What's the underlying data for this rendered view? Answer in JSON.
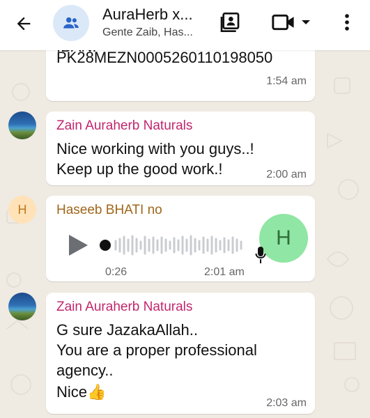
{
  "header": {
    "back_icon": "arrow-left-icon",
    "group_icon": "group-icon",
    "title": "AuraHerb x...",
    "subtitle": "Gente Zaib, Has...",
    "contacts_icon": "contact-card-icon",
    "video_icon": "video-camera-icon",
    "dropdown_icon": "caret-down-icon",
    "menu_icon": "more-vertical-icon"
  },
  "messages": [
    {
      "partial_top_text": "IBAN:",
      "lines": [
        "PK28MEZN0005260110198050"
      ],
      "time": "1:54 am"
    },
    {
      "sender": "Zain Auraherb Naturals",
      "sender_color": "#c0266d",
      "lines": [
        "Nice working with you guys..!",
        "Keep up the good work.!"
      ],
      "time": "2:00 am"
    },
    {
      "sender": "Haseeb BHATI no",
      "sender_color": "#a0661a",
      "avatar_letter": "H",
      "voice": {
        "duration": "0:26",
        "time": "2:01 am",
        "badge_letter": "H",
        "play_icon": "play-icon",
        "mic_icon": "microphone-icon"
      }
    },
    {
      "sender": "Zain Auraherb Naturals",
      "sender_color": "#c0266d",
      "lines": [
        "G sure JazakaAllah..",
        "You are a proper professional",
        "agency..",
        "Nice👍"
      ],
      "time": "2:03 am"
    }
  ],
  "colors": {
    "chat_background": "#efeae2",
    "bubble": "#ffffff",
    "voice_badge": "#90e6a4"
  }
}
